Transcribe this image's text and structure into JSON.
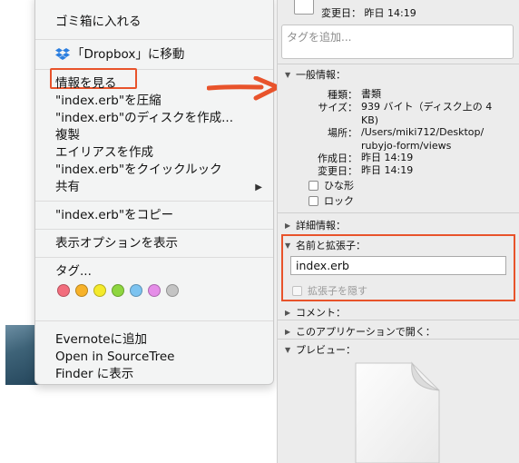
{
  "context_menu": {
    "items": [
      {
        "label": "ゴミ箱に入れる"
      },
      {
        "label": "「Dropbox」に移動"
      },
      {
        "label": "情報を見る"
      },
      {
        "label": "\"index.erb\"を圧縮"
      },
      {
        "label": "\"index.erb\"のディスクを作成..."
      },
      {
        "label": "複製"
      },
      {
        "label": "エイリアスを作成"
      },
      {
        "label": "\"index.erb\"をクイックルック"
      },
      {
        "label": "共有"
      },
      {
        "label": "\"index.erb\"をコピー"
      },
      {
        "label": "表示オプションを表示"
      },
      {
        "label": "タグ..."
      },
      {
        "label": "Evernoteに追加"
      },
      {
        "label": "Open in SourceTree"
      },
      {
        "label": "Finder に表示"
      }
    ],
    "tag_colors": [
      "#f26d7d",
      "#f7b229",
      "#f4ea2b",
      "#8ed63f",
      "#7cc3f0",
      "#e58de8",
      "#c4c4c4"
    ],
    "highlight_color": "#e8532b"
  },
  "info_panel": {
    "modified_top": "変更日： 昨日 14:19",
    "tag_placeholder": "タグを追加...",
    "general": {
      "header": "一般情報：",
      "rows": [
        {
          "key": "種類：",
          "value": "書類"
        },
        {
          "key": "サイズ：",
          "value": "939 バイト（ディスク上の 4 KB)"
        },
        {
          "key": "場所：",
          "value": "/Users/miki712/Desktop/ rubyjo-form/views"
        },
        {
          "key": "作成日：",
          "value": "昨日 14:19"
        },
        {
          "key": "変更日：",
          "value": "昨日 14:19"
        }
      ],
      "checkbox_stationery": "ひな形",
      "checkbox_locked": "ロック"
    },
    "more_info_header": "詳細情報：",
    "name_ext": {
      "header": "名前と拡張子：",
      "filename": "index.erb",
      "hide_extension": "拡張子を隠す"
    },
    "comments_header": "コメント：",
    "open_with_header": "このアプリケーションで開く：",
    "preview_header": "プレビュー："
  }
}
